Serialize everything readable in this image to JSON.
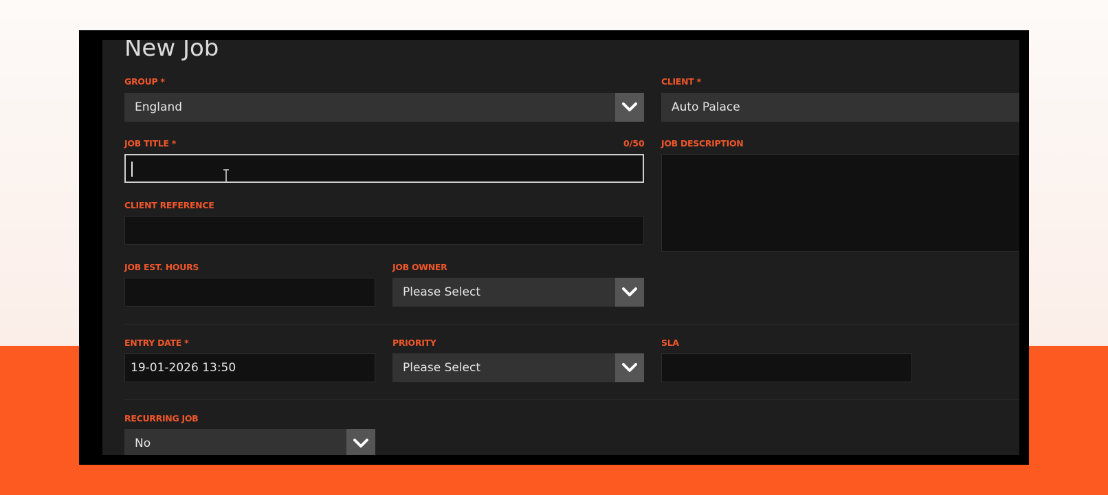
{
  "form": {
    "title": "New Job",
    "group": {
      "label": "GROUP *",
      "value": "England"
    },
    "client": {
      "label": "CLIENT *",
      "value": "Auto Palace"
    },
    "job_title": {
      "label": "JOB TITLE *",
      "counter": "0/50",
      "value": ""
    },
    "job_description": {
      "label": "JOB DESCRIPTION",
      "value": ""
    },
    "client_reference": {
      "label": "CLIENT REFERENCE",
      "value": ""
    },
    "job_est_hours": {
      "label": "JOB EST. HOURS",
      "value": ""
    },
    "job_owner": {
      "label": "JOB OWNER",
      "value": "Please Select"
    },
    "entry_date": {
      "label": "ENTRY DATE *",
      "value": "19-01-2026 13:50"
    },
    "priority": {
      "label": "PRIORITY",
      "value": "Please Select"
    },
    "sla": {
      "label": "SLA",
      "value": ""
    },
    "recurring_job": {
      "label": "RECURRING JOB",
      "value": "No"
    }
  },
  "icons": {
    "dropdown": "chevron-down-icon",
    "cursor": "text-cursor-icon"
  },
  "colors": {
    "label": "#f0562a",
    "background_accent": "#fc5a20",
    "panel": "#1e1e1e"
  }
}
